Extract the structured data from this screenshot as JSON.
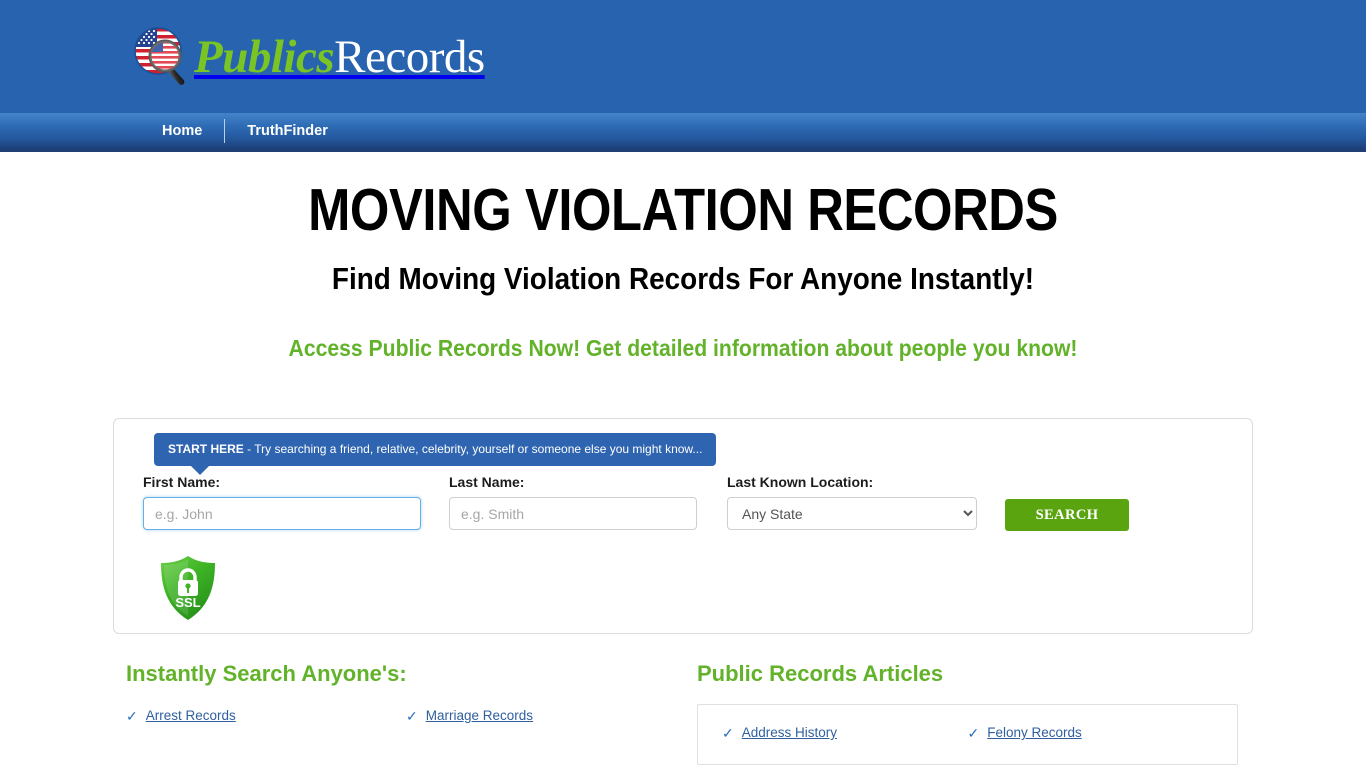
{
  "header": {
    "logo_icon": "us-flag-magnifier-icon",
    "logo_text_primary": "Publics",
    "logo_text_secondary": "Records"
  },
  "nav": {
    "items": [
      {
        "label": "Home"
      },
      {
        "label": "TruthFinder"
      }
    ]
  },
  "hero": {
    "title": "MOVING VIOLATION RECORDS",
    "subtitle": "Find Moving Violation Records For Anyone Instantly!",
    "tagline": "Access Public Records Now! Get detailed information about people you know!",
    "tagline_color": "#62b22a"
  },
  "search": {
    "badge_strong": "START HERE",
    "badge_rest": " - Try searching a friend, relative, celebrity, yourself or someone else you might know...",
    "first_name_label": "First Name:",
    "first_name_value": "",
    "first_name_placeholder": "e.g. John",
    "last_name_label": "Last Name:",
    "last_name_value": "",
    "last_name_placeholder": "e.g. Smith",
    "location_label": "Last Known Location:",
    "location_selected": "Any State",
    "location_options": [
      "Any State"
    ],
    "submit_label": "SEARCH",
    "submit_color": "#5aa50f",
    "ssl_badge_icon": "ssl-shield-lock-icon",
    "ssl_badge_text": "SSL"
  },
  "lower_left": {
    "title": "Instantly Search Anyone's:",
    "links": [
      {
        "label": "Arrest Records"
      },
      {
        "label": "Marriage Records"
      }
    ]
  },
  "lower_right": {
    "title": "Public Records Articles",
    "links": [
      {
        "label": "Address History"
      },
      {
        "label": "Felony Records"
      }
    ]
  }
}
